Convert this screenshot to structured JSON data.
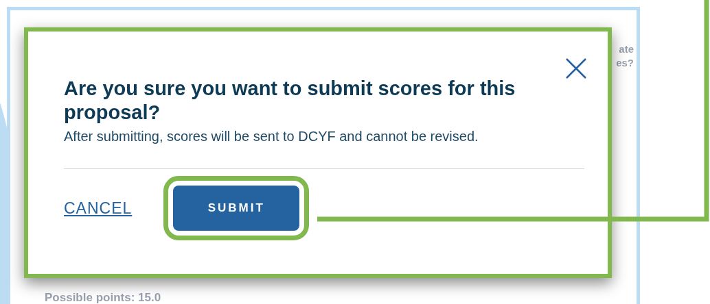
{
  "background_page": {
    "fragments": [
      "ate",
      "es?"
    ],
    "footer": "Possible points: 15.0"
  },
  "dialog": {
    "title": "Are you sure you want to submit scores for this proposal?",
    "message": "After submitting, scores will be sent to DCYF and cannot be revised.",
    "highlighted": true,
    "buttons": [
      {
        "label": "CANCEL",
        "kind": "link",
        "highlighted": false
      },
      {
        "label": "SUBMIT",
        "kind": "primary",
        "highlighted": true
      }
    ]
  }
}
